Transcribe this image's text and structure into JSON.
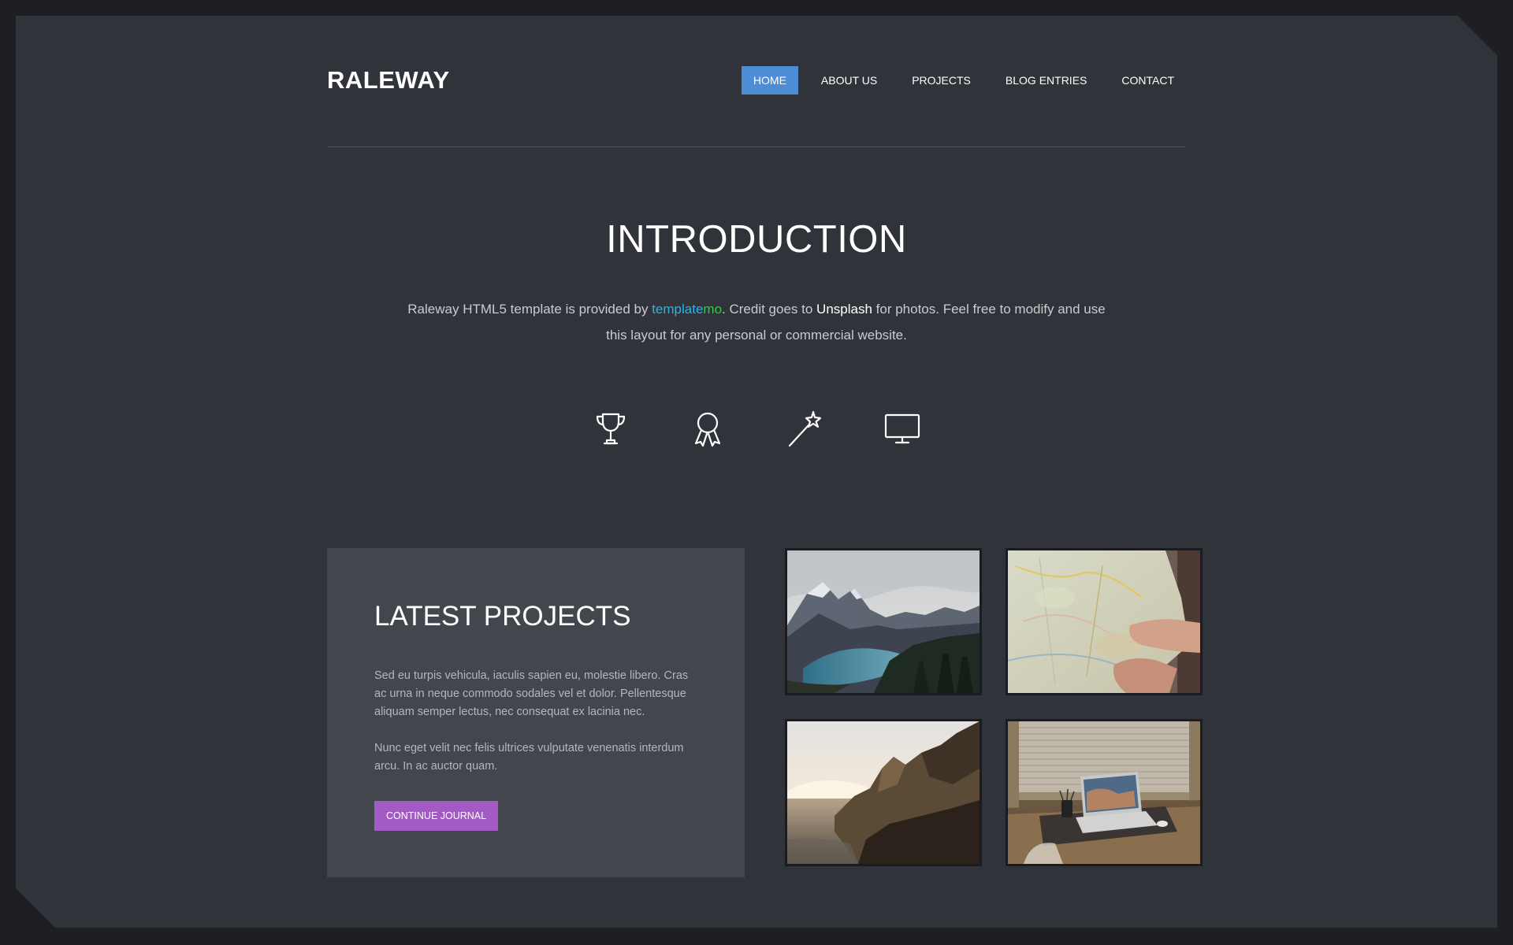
{
  "site": {
    "logo": "RALEWAY"
  },
  "nav": {
    "items": [
      {
        "label": "HOME",
        "active": true
      },
      {
        "label": "ABOUT US",
        "active": false
      },
      {
        "label": "PROJECTS",
        "active": false
      },
      {
        "label": "BLOG ENTRIES",
        "active": false
      },
      {
        "label": "CONTACT",
        "active": false
      }
    ]
  },
  "intro": {
    "title": "INTRODUCTION",
    "text_before": "Raleway HTML5 template is provided by ",
    "brand_part1": "template",
    "brand_part2": "mo",
    "text_middle": ". Credit goes to ",
    "credit_link": "Unsplash",
    "text_after": " for photos. Feel free to modify and use this layout for any personal or commercial website.",
    "icons": [
      "trophy-icon",
      "award-ribbon-icon",
      "magic-wand-icon",
      "monitor-icon"
    ]
  },
  "projects": {
    "title": "LATEST PROJECTS",
    "paragraph1": "Sed eu turpis vehicula, iaculis sapien eu, molestie libero. Cras ac urna in neque commodo sodales vel et dolor. Pellentesque aliquam semper lectus, nec consequat ex lacinia nec.",
    "paragraph2": "Nunc eget velit nec felis ultrices vulputate venenatis interdum arcu. In ac auctor quam.",
    "button_label": "CONTINUE JOURNAL",
    "images": [
      {
        "subject": "mountain-lake-photo"
      },
      {
        "subject": "hands-holding-map-photo"
      },
      {
        "subject": "coastal-cliffs-sunset-photo"
      },
      {
        "subject": "laptop-on-desk-photo"
      }
    ]
  },
  "colors": {
    "background": "#30333a",
    "outer": "#1d1f22",
    "panel": "#43464d",
    "nav_active": "#4c8dd5",
    "cta": "#a35bc4",
    "brand_blue": "#2ab3ea",
    "brand_green": "#2ecc40"
  }
}
